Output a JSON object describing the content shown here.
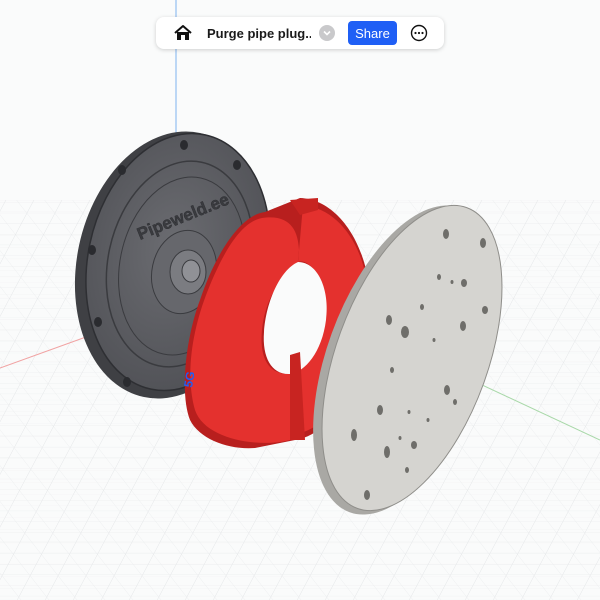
{
  "toolbar": {
    "home_icon": "home-icon",
    "document_title": "Purge pipe plug...",
    "dropdown_icon": "chevron-down-icon",
    "share_label": "Share",
    "more_icon": "more-options-icon"
  },
  "model": {
    "engraved_text": "Pipeweld.ee",
    "colors": {
      "flange": "#5c5d62",
      "ring": "#e4312e",
      "plate": "#d5d4d0",
      "accent": "#1f5ff5"
    }
  }
}
